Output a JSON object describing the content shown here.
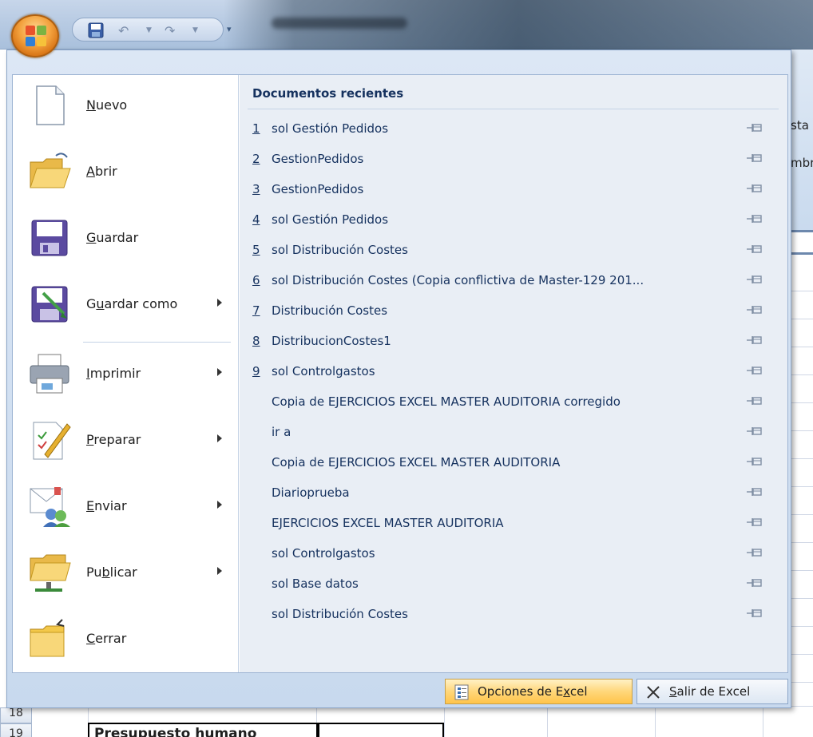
{
  "menu": {
    "items": [
      {
        "label": "Nuevo",
        "key": "N",
        "icon": "new-document-icon",
        "submenu": false
      },
      {
        "label": "Abrir",
        "key": "A",
        "icon": "open-folder-icon",
        "submenu": false
      },
      {
        "label": "Guardar",
        "key": "G",
        "icon": "save-disk-icon",
        "submenu": false
      },
      {
        "label": "Guardar como",
        "key": "u",
        "icon": "save-as-icon",
        "submenu": true
      },
      {
        "label": "Imprimir",
        "key": "I",
        "icon": "printer-icon",
        "submenu": true
      },
      {
        "label": "Preparar",
        "key": "P",
        "icon": "prepare-document-icon",
        "submenu": true
      },
      {
        "label": "Enviar",
        "key": "E",
        "icon": "send-email-icon",
        "submenu": true
      },
      {
        "label": "Publicar",
        "key": "b",
        "icon": "publish-server-icon",
        "submenu": true
      },
      {
        "label": "Cerrar",
        "key": "C",
        "icon": "close-folder-icon",
        "submenu": false
      }
    ],
    "labels": {
      "nuevo_pre": "",
      "nuevo_key": "N",
      "nuevo_post": "uevo",
      "abrir_pre": "",
      "abrir_key": "A",
      "abrir_post": "brir",
      "guardar_pre": "",
      "guardar_key": "G",
      "guardar_post": "uardar",
      "guardarcomo_pre": "G",
      "guardarcomo_key": "u",
      "guardarcomo_post": "ardar como",
      "imprimir_pre": "",
      "imprimir_key": "I",
      "imprimir_post": "mprimir",
      "preparar_pre": "",
      "preparar_key": "P",
      "preparar_post": "reparar",
      "enviar_pre": "",
      "enviar_key": "E",
      "enviar_post": "nviar",
      "publicar_pre": "Pu",
      "publicar_key": "b",
      "publicar_post": "licar",
      "cerrar_pre": "",
      "cerrar_key": "C",
      "cerrar_post": "errar"
    }
  },
  "recent": {
    "title": "Documentos recientes",
    "items": [
      {
        "num": "1",
        "name": "sol Gestión Pedidos"
      },
      {
        "num": "2",
        "name": "GestionPedidos"
      },
      {
        "num": "3",
        "name": "GestionPedidos"
      },
      {
        "num": "4",
        "name": "sol Gestión Pedidos"
      },
      {
        "num": "5",
        "name": "sol Distribución Costes"
      },
      {
        "num": "6",
        "name": "sol Distribución Costes (Copia conflictiva de Master-129 201..."
      },
      {
        "num": "7",
        "name": "Distribución Costes"
      },
      {
        "num": "8",
        "name": "DistribucionCostes1"
      },
      {
        "num": "9",
        "name": "sol Controlgastos"
      },
      {
        "num": "",
        "name": "Copia de EJERCICIOS EXCEL MASTER AUDITORIA corregido"
      },
      {
        "num": "",
        "name": "ir a"
      },
      {
        "num": "",
        "name": "Copia de EJERCICIOS EXCEL MASTER AUDITORIA"
      },
      {
        "num": "",
        "name": "Diarioprueba"
      },
      {
        "num": "",
        "name": "EJERCICIOS EXCEL MASTER AUDITORIA"
      },
      {
        "num": "",
        "name": "sol Controlgastos"
      },
      {
        "num": "",
        "name": "sol Base datos"
      },
      {
        "num": "",
        "name": "sol Distribución Costes"
      }
    ]
  },
  "buttons": {
    "options_pre": "Opciones de E",
    "options_key": "x",
    "options_post": "cel",
    "exit_pre": "",
    "exit_key": "S",
    "exit_post": "alir de Excel"
  },
  "background": {
    "ribbon_text1": "sta",
    "ribbon_text2": "mbr",
    "row_a": "18",
    "row_b": "19",
    "cell_text": "Presupuesto humano"
  },
  "colors": {
    "menu_bg": "#dce7f5",
    "recent_text": "#15315e",
    "options_button": "#ffd77a"
  }
}
